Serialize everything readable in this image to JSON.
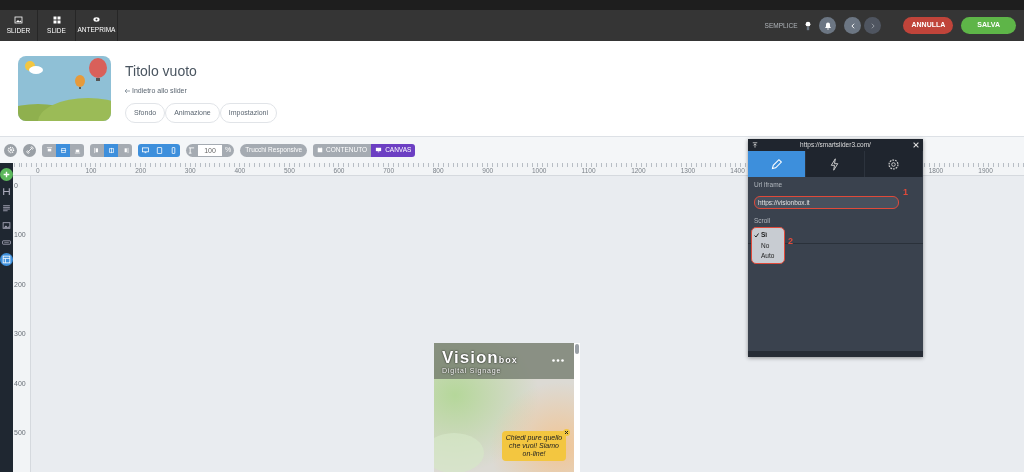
{
  "top_tabs": [
    {
      "label": "SLIDER"
    },
    {
      "label": "SLIDE"
    },
    {
      "label": "ANTEPRIMA"
    }
  ],
  "top_right": {
    "mode_label": "SEMPLICE",
    "cancel_button": "ANNULLA",
    "save_button": "SALVA"
  },
  "header": {
    "title": "Titolo vuoto",
    "back_link": "Indietro allo slider",
    "pills": [
      "Sfondo",
      "Animazione",
      "Impostazioni"
    ]
  },
  "toolbar": {
    "align_vertical": [
      {
        "selected": false
      },
      {
        "selected": true
      },
      {
        "selected": false
      }
    ],
    "align_horizontal": [
      {
        "selected": false
      },
      {
        "selected": true
      },
      {
        "selected": false
      }
    ],
    "devices": [
      {
        "selected": true
      },
      {
        "selected": true
      },
      {
        "selected": true
      }
    ],
    "zoom": {
      "value": "100",
      "unit": "%"
    },
    "responsive_button": "Trucchi Responsive",
    "view_toggle": [
      {
        "label": "CONTENUTO",
        "selected": false
      },
      {
        "label": "CANVAS",
        "selected": true
      }
    ]
  },
  "sidebar": {
    "tools": [
      {
        "selected": false
      },
      {
        "selected": false
      },
      {
        "selected": false
      },
      {
        "selected": false
      },
      {
        "selected": true
      }
    ]
  },
  "ruler": {
    "horizontal": [
      "0",
      "100",
      "200",
      "300",
      "400",
      "500",
      "600",
      "700",
      "800",
      "900",
      "1000",
      "1100",
      "1200",
      "1300",
      "1400",
      "1800",
      "1900"
    ],
    "vertical": [
      "0",
      "100",
      "200",
      "300",
      "400",
      "500"
    ]
  },
  "preview": {
    "logo_main": "Vision",
    "logo_suffix": "box",
    "tagline": "Digital Signage",
    "chat_text": "Chiedi pure quello che vuoi! Siamo on-line!"
  },
  "panel": {
    "url": "https://smartslider3.com/",
    "tabs": [
      {
        "selected": true
      },
      {
        "selected": false
      },
      {
        "selected": false
      }
    ],
    "url_label": "Url iframe",
    "url_value": "https://visionbox.it",
    "scroll_label": "Scroll",
    "scroll_options": [
      {
        "label": "Sì",
        "selected": true
      },
      {
        "label": "No",
        "selected": false
      },
      {
        "label": "Auto",
        "selected": false
      }
    ],
    "annotations": [
      "1",
      "2"
    ]
  }
}
